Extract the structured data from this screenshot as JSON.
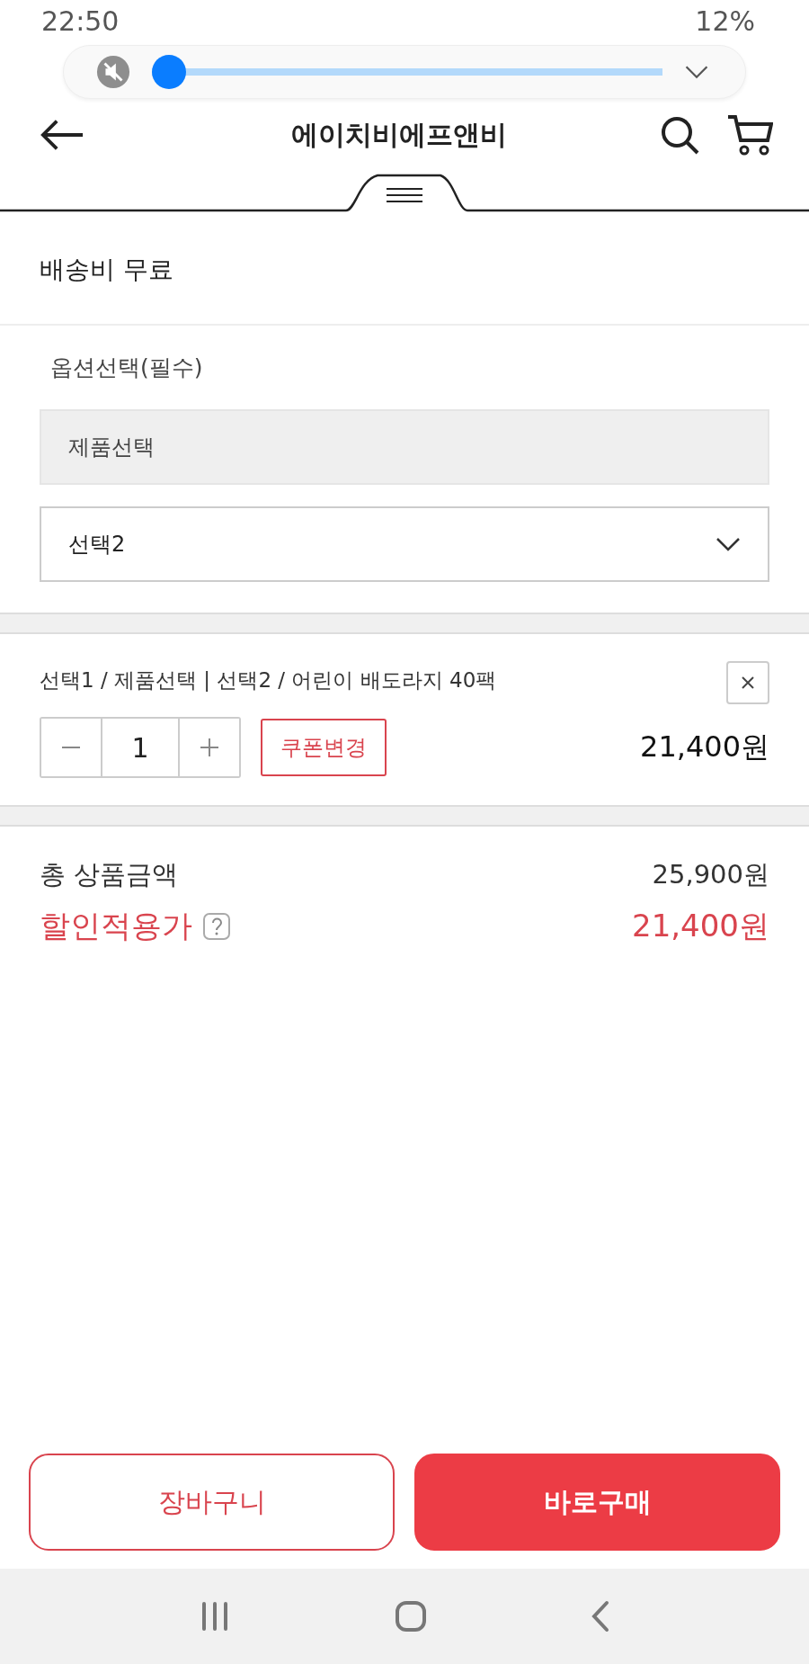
{
  "status_bar": {
    "time": "22:50",
    "battery": "12%"
  },
  "volume_panel": {
    "muted": true,
    "level": 0
  },
  "header": {
    "title": "에이치비에프앤비"
  },
  "shipping": {
    "text": "배송비 무료"
  },
  "options": {
    "label": "옵션선택(필수)",
    "product_field": {
      "value": "제품선택",
      "disabled": true
    },
    "select": {
      "value": "선택2"
    }
  },
  "selected_item": {
    "name": "선택1 / 제품선택 | 선택2 / 어린이 배도라지 40팩",
    "quantity": "1",
    "coupon_button": "쿠폰변경",
    "price": "21,400원"
  },
  "summary": {
    "total_label": "총 상품금액",
    "total_value": "25,900원",
    "discount_label": "할인적용가",
    "discount_value": "21,400원"
  },
  "buttons": [
    {
      "label": "장바구니",
      "kind": "outline"
    },
    {
      "label": "바로구매",
      "kind": "filled"
    }
  ]
}
